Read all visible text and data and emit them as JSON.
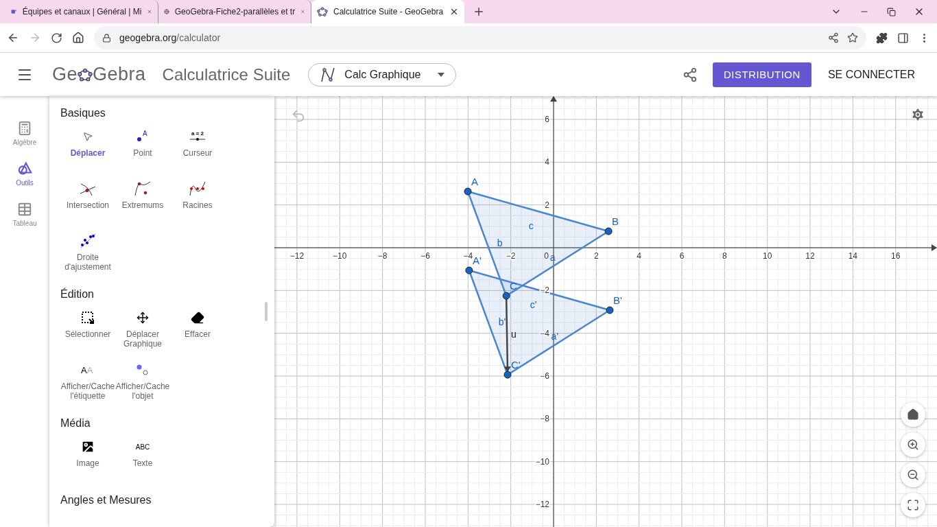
{
  "browser": {
    "tabs": [
      {
        "title": "Équipes et canaux | Général | Mi",
        "kind": "teams",
        "selected": false
      },
      {
        "title": "GeoGebra-Fiche2-parallèles et tr",
        "kind": "globe",
        "selected": false
      },
      {
        "title": "Calculatrice Suite - GeoGebra",
        "kind": "geogebra",
        "selected": true
      }
    ],
    "url_host": "geogebra.org",
    "url_path": "/calculator",
    "forward_disabled": true
  },
  "header": {
    "logo_before": "Ge",
    "logo_after": "Gebra",
    "title": "Calculatrice Suite",
    "app_picker": "Calc Graphique",
    "distribution": "DISTRIBUTION",
    "login": "SE CONNECTER"
  },
  "rail": [
    {
      "label": "Algèbre",
      "kind": "calculator",
      "selected": false
    },
    {
      "label": "Outils",
      "kind": "tools",
      "selected": true
    },
    {
      "label": "Tableau",
      "kind": "table",
      "selected": false
    }
  ],
  "tool_sections": [
    {
      "title": "Basiques",
      "tools": [
        {
          "label": "Déplacer",
          "kind": "move",
          "selected": true
        },
        {
          "label": "Point",
          "kind": "point",
          "icon_text": "A",
          "selected": false
        },
        {
          "label": "Curseur",
          "kind": "slider",
          "icon_text": "a = 2",
          "selected": false
        },
        {
          "label": "Intersection",
          "kind": "intersect",
          "selected": false
        },
        {
          "label": "Extremums",
          "kind": "extremum",
          "selected": false
        },
        {
          "label": "Racines",
          "kind": "roots",
          "selected": false
        },
        {
          "label": "Droite d'ajustement",
          "kind": "fitline",
          "selected": false
        }
      ]
    },
    {
      "title": "Édition",
      "tools": [
        {
          "label": "Sélectionner",
          "kind": "select",
          "selected": false
        },
        {
          "label": "Déplacer Graphique",
          "kind": "pan",
          "selected": false
        },
        {
          "label": "Effacer",
          "kind": "erase",
          "selected": false
        },
        {
          "label": "Afficher/Cache l'étiquette",
          "kind": "showlabel",
          "icon_text": "AA",
          "selected": false
        },
        {
          "label": "Afficher/Cache l'objet",
          "kind": "showobject",
          "selected": false
        }
      ]
    },
    {
      "title": "Média",
      "tools": [
        {
          "label": "Image",
          "kind": "image",
          "selected": false
        },
        {
          "label": "Texte",
          "kind": "text",
          "icon_text": "ABC",
          "selected": false
        }
      ]
    },
    {
      "title": "Angles et Mesures"
    }
  ],
  "graph": {
    "x_ticks": [
      "−12",
      "−10",
      "−8",
      "−6",
      "−4",
      "−2",
      "2",
      "4",
      "6",
      "8",
      "10",
      "12",
      "14",
      "16"
    ],
    "y_ticks": [
      "6",
      "4",
      "2",
      "−2",
      "−4",
      "−6",
      "−8",
      "−10",
      "−12"
    ],
    "origin_label": "0",
    "points": [
      {
        "name": "A"
      },
      {
        "name": "B"
      },
      {
        "name": "C"
      },
      {
        "name": "A'"
      },
      {
        "name": "B'"
      },
      {
        "name": "C'"
      }
    ],
    "triangles": [
      {
        "sides": [
          "a",
          "b",
          "c"
        ]
      },
      {
        "sides": [
          "a'",
          "b'",
          "c'"
        ]
      }
    ],
    "vector": {
      "label": "u"
    }
  }
}
